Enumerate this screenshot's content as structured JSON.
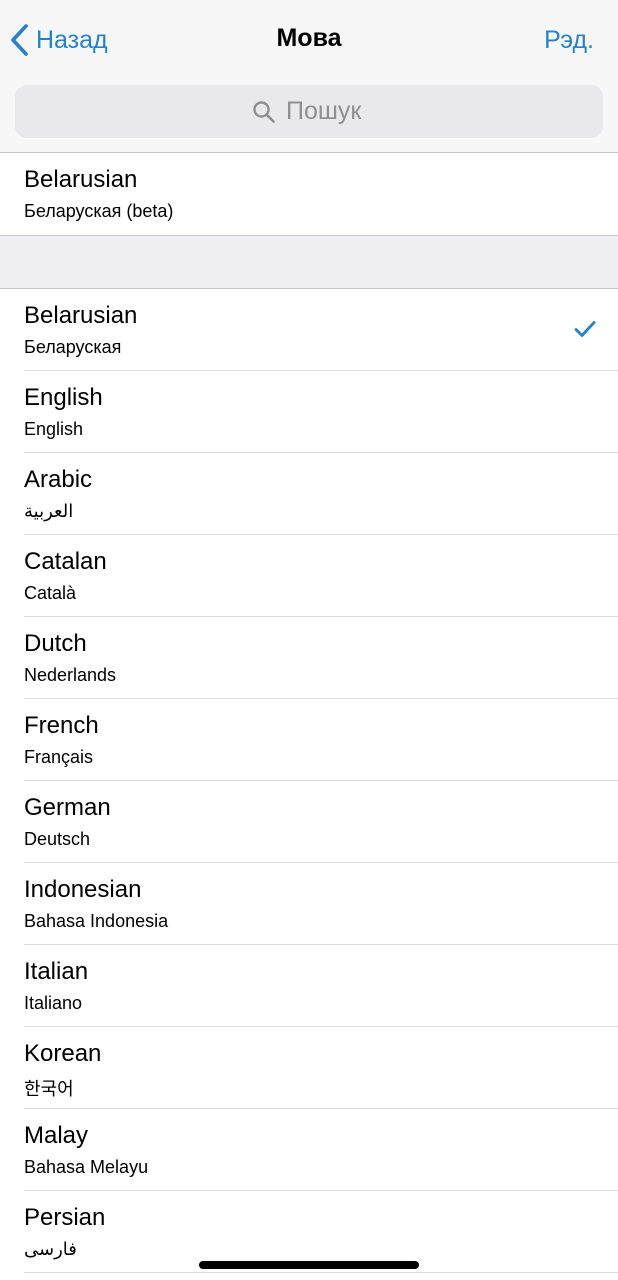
{
  "nav": {
    "back_label": "Назад",
    "title": "Мова",
    "edit_label": "Рэд.",
    "accent_color": "#2481cc"
  },
  "search": {
    "placeholder": "Пошук",
    "value": "",
    "icon": "magnifier-icon"
  },
  "suggested": [
    {
      "name": "Belarusian",
      "native": "Беларуская (beta)"
    }
  ],
  "languages": [
    {
      "name": "Belarusian",
      "native": "Беларуская",
      "selected": true
    },
    {
      "name": "English",
      "native": "English"
    },
    {
      "name": "Arabic",
      "native": "العربية"
    },
    {
      "name": "Catalan",
      "native": "Català"
    },
    {
      "name": "Dutch",
      "native": "Nederlands"
    },
    {
      "name": "French",
      "native": "Français"
    },
    {
      "name": "German",
      "native": "Deutsch"
    },
    {
      "name": "Indonesian",
      "native": "Bahasa Indonesia"
    },
    {
      "name": "Italian",
      "native": "Italiano"
    },
    {
      "name": "Korean",
      "native": "한국어"
    },
    {
      "name": "Malay",
      "native": "Bahasa Melayu"
    },
    {
      "name": "Persian",
      "native": "فارسی"
    }
  ]
}
